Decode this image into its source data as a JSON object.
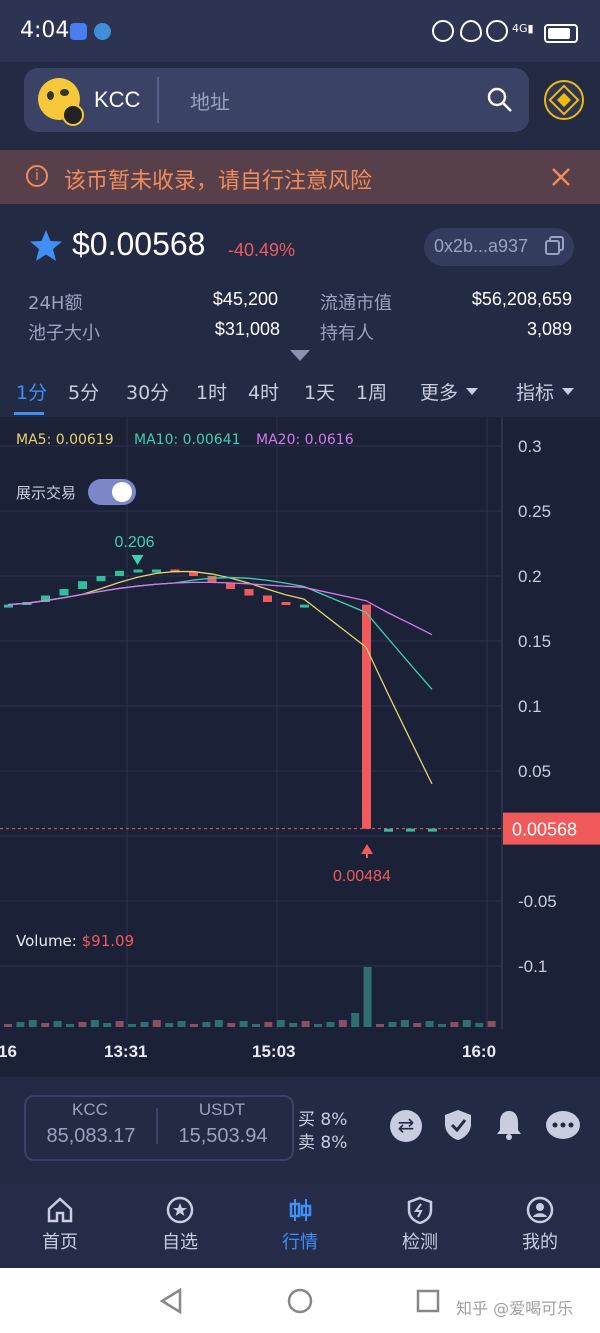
{
  "status_bar": {
    "time": "4:04"
  },
  "search": {
    "chain": "KCC",
    "placeholder": "地址"
  },
  "warning": {
    "text": "该币暂未收录，请自行注意风险"
  },
  "token": {
    "price": "$0.00568",
    "change": "-40.49%",
    "address": "0x2b...a937",
    "stats": [
      {
        "label": "24H额",
        "value": "$45,200"
      },
      {
        "label": "流通市值",
        "value": "$56,208,659"
      },
      {
        "label": "池子大小",
        "value": "$31,008"
      },
      {
        "label": "持有人",
        "value": "3,089"
      }
    ]
  },
  "intervals": [
    "1分",
    "5分",
    "30分",
    "1时",
    "4时",
    "1天",
    "1周",
    "更多",
    "指标"
  ],
  "chart_data": {
    "type": "candlestick",
    "indicators": {
      "ma5": "MA5: 0.00619",
      "ma10": "MA10: 0.00641",
      "ma20": "MA20: 0.0616"
    },
    "toggle_label": "展示交易",
    "toggle_on": true,
    "y_ticks": [
      "0.3",
      "0.25",
      "0.2",
      "0.15",
      "0.1",
      "0.05",
      "0",
      "-0.05",
      "-0.1"
    ],
    "x_ticks": [
      "16",
      "13:31",
      "15:03",
      "16:0"
    ],
    "price_line_label": "0.00568",
    "high_label": "0.206",
    "low_label": "0.00484",
    "volume_label": "Volume: ",
    "volume_value": "$91.09",
    "close_series": [
      0.178,
      0.18,
      0.185,
      0.19,
      0.196,
      0.2,
      0.204,
      0.205,
      0.205,
      0.203,
      0.2,
      0.195,
      0.19,
      0.185,
      0.18,
      0.178,
      0.178,
      0.0055,
      0.0056,
      0.0057,
      0.0057
    ],
    "colors": {
      "up": "#2fbf9f",
      "down": "#f05a5a",
      "ma5": "#e8d36a",
      "ma10": "#3fd0b0",
      "ma20": "#d57ae8"
    }
  },
  "balances": {
    "token_name": "KCC",
    "token_amount": "85,083.17",
    "quote_name": "USDT",
    "quote_amount": "15,503.94",
    "buy_tax": "买 8%",
    "sell_tax": "卖 8%"
  },
  "bottom_nav": [
    "首页",
    "自选",
    "行情",
    "检测",
    "我的"
  ],
  "watermark": "知乎 @爱喝可乐"
}
